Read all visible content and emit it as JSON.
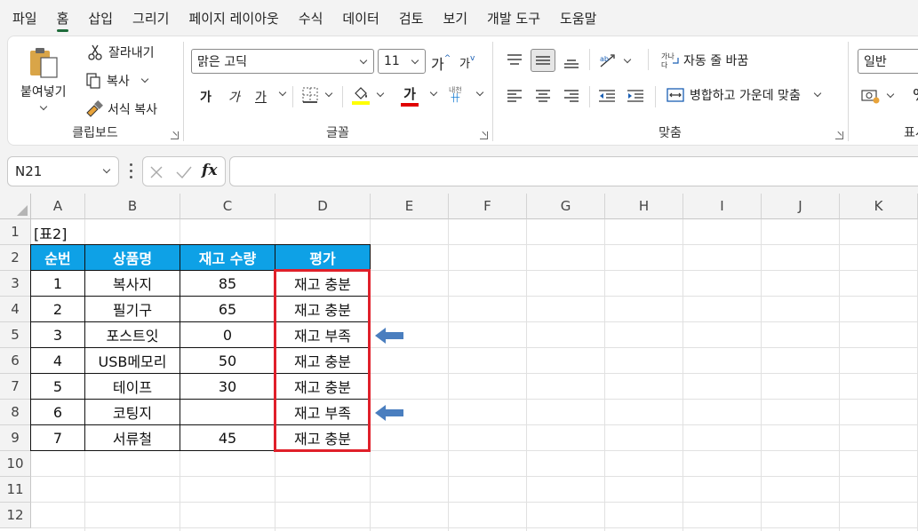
{
  "menu": [
    "파일",
    "홈",
    "삽입",
    "그리기",
    "페이지 레이아웃",
    "수식",
    "데이터",
    "검토",
    "보기",
    "개발 도구",
    "도움말"
  ],
  "ribbon": {
    "clipboard": {
      "paste": "붙여넣기",
      "cut": "잘라내기",
      "copy": "복사",
      "format_painter": "서식 복사",
      "label": "클립보드"
    },
    "font": {
      "name": "맑은 고딕",
      "size": "11",
      "grow": "가",
      "shrink": "가",
      "bold": "가",
      "italic": "가",
      "underline": "가",
      "fill_color": "#ffff00",
      "font_color_glyph": "가",
      "font_color": "#e00000",
      "phonetic": "내천",
      "label": "글꼴"
    },
    "alignment": {
      "wrap": "자동 줄 바꿈",
      "merge": "병합하고 가운데 맞춤",
      "label": "맞춤"
    },
    "number": {
      "format": "일반",
      "percent": "%",
      "label": "표시"
    }
  },
  "formula_bar": {
    "name_box": "N21",
    "fx": "fx",
    "formula": ""
  },
  "columns": [
    "A",
    "B",
    "C",
    "D",
    "E",
    "F",
    "G",
    "H",
    "I",
    "J",
    "K"
  ],
  "rows": [
    "1",
    "2",
    "3",
    "4",
    "5",
    "6",
    "7",
    "8",
    "9",
    "10",
    "11",
    "12"
  ],
  "table": {
    "caption": "[표2]",
    "header_color": "#0ea1e6",
    "headers": [
      "순번",
      "상품명",
      "재고 수량",
      "평가"
    ],
    "rows": [
      [
        "1",
        "복사지",
        "85",
        "재고 충분"
      ],
      [
        "2",
        "필기구",
        "65",
        "재고 충분"
      ],
      [
        "3",
        "포스트잇",
        "0",
        "재고 부족"
      ],
      [
        "4",
        "USB메모리",
        "50",
        "재고 충분"
      ],
      [
        "5",
        "테이프",
        "30",
        "재고 충분"
      ],
      [
        "6",
        "코팅지",
        "",
        "재고 부족"
      ],
      [
        "7",
        "서류철",
        "45",
        "재고 충분"
      ]
    ]
  },
  "highlight_color": "#e0202a",
  "arrow_color": "#4a7ebf"
}
